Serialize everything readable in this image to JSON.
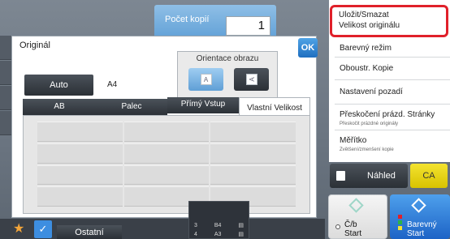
{
  "copies": {
    "label": "Počet kopií",
    "value": "1"
  },
  "dialog": {
    "title": "Originál",
    "ok_label": "OK",
    "orientation": {
      "label": "Orientace obrazu",
      "portrait_glyph": "A",
      "landscape_glyph": "A"
    },
    "auto_label": "Auto",
    "auto_value": "A4",
    "tabs": [
      {
        "label": "AB"
      },
      {
        "label": "Palec"
      },
      {
        "label": "Přímý Vstup"
      },
      {
        "label": "Vlastní Velikost"
      }
    ]
  },
  "menu": {
    "items": [
      {
        "label": "Uložit/Smazat",
        "label2": "Velikost originálu"
      },
      {
        "label": "Barevný režim"
      },
      {
        "label": "Oboustr. Kopie"
      },
      {
        "label": "Nastavení pozadí"
      },
      {
        "label": "Přeskočení prázd. Stránky",
        "sub": "Přeskočit prázdné originály"
      },
      {
        "label": "Měřítko",
        "sub": "Zvětšení/zmenšení kopie"
      }
    ]
  },
  "actions": {
    "preview_label": "Náhled",
    "ca_label": "CA"
  },
  "start": {
    "bw": {
      "label1": "Č/b",
      "label2": "Start"
    },
    "color": {
      "label1": "Barevný",
      "label2": "Start"
    }
  },
  "bottom": {
    "other_label": "Ostatní"
  },
  "tray": {
    "rows": [
      {
        "num": "3",
        "size": "B4"
      },
      {
        "num": "4",
        "size": "A3"
      }
    ]
  },
  "colors": {
    "accent": "#3d8ee0",
    "highlight": "#e0202a",
    "ca": "#f3e330"
  }
}
